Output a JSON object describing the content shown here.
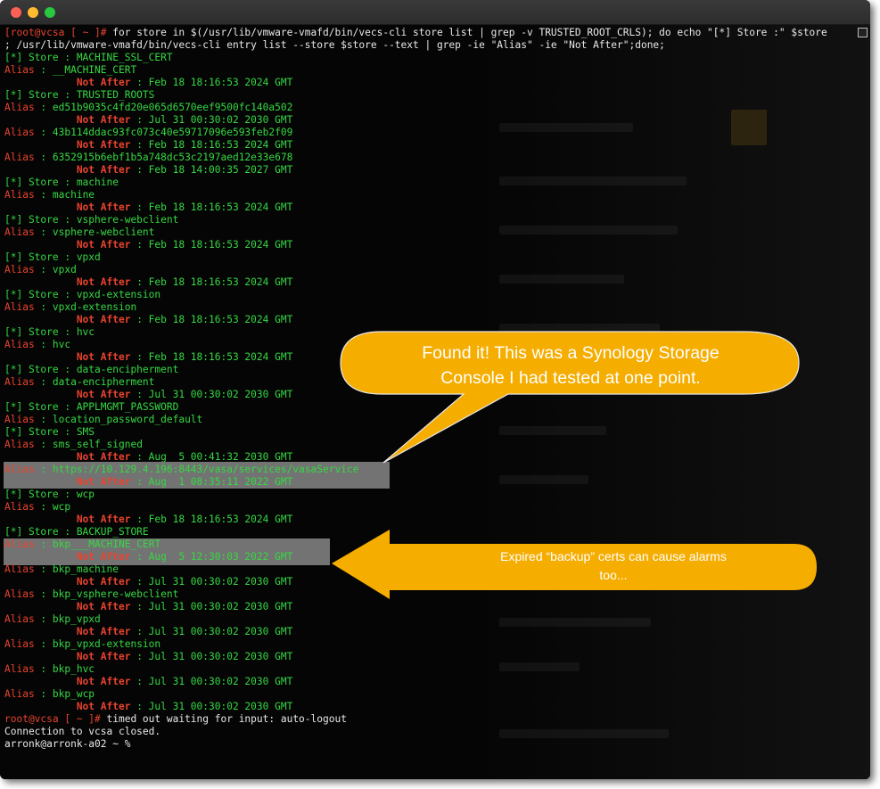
{
  "window": {
    "buttons": [
      "close",
      "minimize",
      "zoom"
    ]
  },
  "terminal": {
    "lines": [
      [
        {
          "t": "[root@vcsa ",
          "c": "red"
        },
        {
          "t": "[ ~ ]# ",
          "c": "red"
        },
        {
          "t": "for store in $(/usr/lib/vmware-vmafd/bin/vecs-cli store list | grep -v TRUSTED_ROOT_CRLS); do echo \"[*] Store :\" $store",
          "c": "white"
        }
      ],
      [
        {
          "t": "; /usr/lib/vmware-vmafd/bin/vecs-cli entry list --store $store --text | grep -ie \"Alias\" -ie \"Not After\";done;",
          "c": "white"
        }
      ],
      [
        {
          "t": "[*] Store : MACHINE_SSL_CERT",
          "c": "green"
        }
      ],
      [
        {
          "t": "Alias",
          "c": "red"
        },
        {
          "t": " : __MACHINE_CERT",
          "c": "green"
        }
      ],
      [
        {
          "t": "            Not After",
          "c": "red-b"
        },
        {
          "t": " : Feb 18 18:16:53 2024 GMT",
          "c": "green"
        }
      ],
      [
        {
          "t": "[*] Store : TRUSTED_ROOTS",
          "c": "green"
        }
      ],
      [
        {
          "t": "Alias",
          "c": "red"
        },
        {
          "t": " : ed51b9035c4fd20e065d6570eef9500fc140a502",
          "c": "green"
        }
      ],
      [
        {
          "t": "            Not After",
          "c": "red-b"
        },
        {
          "t": " : Jul 31 00:30:02 2030 GMT",
          "c": "green"
        }
      ],
      [
        {
          "t": "Alias",
          "c": "red"
        },
        {
          "t": " : 43b114ddac93fc073c40e59717096e593feb2f09",
          "c": "green"
        }
      ],
      [
        {
          "t": "            Not After",
          "c": "red-b"
        },
        {
          "t": " : Feb 18 18:16:53 2024 GMT",
          "c": "green"
        }
      ],
      [
        {
          "t": "Alias",
          "c": "red"
        },
        {
          "t": " : 6352915b6ebf1b5a748dc53c2197aed12e33e678",
          "c": "green"
        }
      ],
      [
        {
          "t": "            Not After",
          "c": "red-b"
        },
        {
          "t": " : Feb 18 14:00:35 2027 GMT",
          "c": "green"
        }
      ],
      [
        {
          "t": "[*] Store : machine",
          "c": "green"
        }
      ],
      [
        {
          "t": "Alias",
          "c": "red"
        },
        {
          "t": " : machine",
          "c": "green"
        }
      ],
      [
        {
          "t": "            Not After",
          "c": "red-b"
        },
        {
          "t": " : Feb 18 18:16:53 2024 GMT",
          "c": "green"
        }
      ],
      [
        {
          "t": "[*] Store : vsphere-webclient",
          "c": "green"
        }
      ],
      [
        {
          "t": "Alias",
          "c": "red"
        },
        {
          "t": " : vsphere-webclient",
          "c": "green"
        }
      ],
      [
        {
          "t": "            Not After",
          "c": "red-b"
        },
        {
          "t": " : Feb 18 18:16:53 2024 GMT",
          "c": "green"
        }
      ],
      [
        {
          "t": "[*] Store : vpxd",
          "c": "green"
        }
      ],
      [
        {
          "t": "Alias",
          "c": "red"
        },
        {
          "t": " : vpxd",
          "c": "green"
        }
      ],
      [
        {
          "t": "            Not After",
          "c": "red-b"
        },
        {
          "t": " : Feb 18 18:16:53 2024 GMT",
          "c": "green"
        }
      ],
      [
        {
          "t": "[*] Store : vpxd-extension",
          "c": "green"
        }
      ],
      [
        {
          "t": "Alias",
          "c": "red"
        },
        {
          "t": " : vpxd-extension",
          "c": "green"
        }
      ],
      [
        {
          "t": "            Not After",
          "c": "red-b"
        },
        {
          "t": " : Feb 18 18:16:53 2024 GMT",
          "c": "green"
        }
      ],
      [
        {
          "t": "[*] Store : hvc",
          "c": "green"
        }
      ],
      [
        {
          "t": "Alias",
          "c": "red"
        },
        {
          "t": " : hvc",
          "c": "green"
        }
      ],
      [
        {
          "t": "            Not After",
          "c": "red-b"
        },
        {
          "t": " : Feb 18 18:16:53 2024 GMT",
          "c": "green"
        }
      ],
      [
        {
          "t": "[*] Store : data-encipherment",
          "c": "green"
        }
      ],
      [
        {
          "t": "Alias",
          "c": "red"
        },
        {
          "t": " : data-encipherment",
          "c": "green"
        }
      ],
      [
        {
          "t": "            Not After",
          "c": "red-b"
        },
        {
          "t": " : Jul 31 00:30:02 2030 GMT",
          "c": "green"
        }
      ],
      [
        {
          "t": "[*] Store : APPLMGMT_PASSWORD",
          "c": "green"
        }
      ],
      [
        {
          "t": "Alias",
          "c": "red"
        },
        {
          "t": " : location_password_default",
          "c": "green"
        }
      ],
      [
        {
          "t": "[*] Store : SMS",
          "c": "green"
        }
      ],
      [
        {
          "t": "Alias",
          "c": "red"
        },
        {
          "t": " : sms_self_signed",
          "c": "green"
        }
      ],
      [
        {
          "t": "            Not After",
          "c": "red-b"
        },
        {
          "t": " : Aug  5 00:41:32 2030 GMT",
          "c": "green"
        }
      ],
      [
        {
          "t": "Alias",
          "c": "red"
        },
        {
          "t": " : https://10.129.4.196:8443/vasa/services/vasaService",
          "c": "green"
        }
      ],
      [
        {
          "t": "            Not After",
          "c": "red-b"
        },
        {
          "t": " : Aug  1 08:35:11 2022 GMT",
          "c": "green"
        }
      ],
      [
        {
          "t": "[*] Store : wcp",
          "c": "green"
        }
      ],
      [
        {
          "t": "Alias",
          "c": "red"
        },
        {
          "t": " : wcp",
          "c": "green"
        }
      ],
      [
        {
          "t": "            Not After",
          "c": "red-b"
        },
        {
          "t": " : Feb 18 18:16:53 2024 GMT",
          "c": "green"
        }
      ],
      [
        {
          "t": "[*] Store : BACKUP_STORE",
          "c": "green"
        }
      ],
      [
        {
          "t": "Alias",
          "c": "red"
        },
        {
          "t": " : bkp___MACHINE_CERT",
          "c": "green"
        }
      ],
      [
        {
          "t": "            Not After",
          "c": "red-b"
        },
        {
          "t": " : Aug  5 12:30:03 2022 GMT",
          "c": "green"
        }
      ],
      [
        {
          "t": "Alias",
          "c": "red"
        },
        {
          "t": " : bkp_machine",
          "c": "green"
        }
      ],
      [
        {
          "t": "            Not After",
          "c": "red-b"
        },
        {
          "t": " : Jul 31 00:30:02 2030 GMT",
          "c": "green"
        }
      ],
      [
        {
          "t": "Alias",
          "c": "red"
        },
        {
          "t": " : bkp_vsphere-webclient",
          "c": "green"
        }
      ],
      [
        {
          "t": "            Not After",
          "c": "red-b"
        },
        {
          "t": " : Jul 31 00:30:02 2030 GMT",
          "c": "green"
        }
      ],
      [
        {
          "t": "Alias",
          "c": "red"
        },
        {
          "t": " : bkp_vpxd",
          "c": "green"
        }
      ],
      [
        {
          "t": "            Not After",
          "c": "red-b"
        },
        {
          "t": " : Jul 31 00:30:02 2030 GMT",
          "c": "green"
        }
      ],
      [
        {
          "t": "Alias",
          "c": "red"
        },
        {
          "t": " : bkp_vpxd-extension",
          "c": "green"
        }
      ],
      [
        {
          "t": "            Not After",
          "c": "red-b"
        },
        {
          "t": " : Jul 31 00:30:02 2030 GMT",
          "c": "green"
        }
      ],
      [
        {
          "t": "Alias",
          "c": "red"
        },
        {
          "t": " : bkp_hvc",
          "c": "green"
        }
      ],
      [
        {
          "t": "            Not After",
          "c": "red-b"
        },
        {
          "t": " : Jul 31 00:30:02 2030 GMT",
          "c": "green"
        }
      ],
      [
        {
          "t": "Alias",
          "c": "red"
        },
        {
          "t": " : bkp_wcp",
          "c": "green"
        }
      ],
      [
        {
          "t": "            Not After",
          "c": "red-b"
        },
        {
          "t": " : Jul 31 00:30:02 2030 GMT",
          "c": "green"
        }
      ],
      [
        {
          "t": "root@vcsa ",
          "c": "red"
        },
        {
          "t": "[ ~ ]# ",
          "c": "red"
        },
        {
          "t": "timed out waiting for input: auto-logout",
          "c": "white"
        }
      ],
      [
        {
          "t": "Connection to vcsa closed.",
          "c": "white"
        }
      ],
      [
        {
          "t": "arronk@arronk-a02 ~ % ",
          "c": "white"
        }
      ]
    ]
  },
  "callouts": {
    "found": {
      "line1": "Found it!  This was a Synology Storage",
      "line2": "Console I had tested at one point."
    },
    "backup": {
      "line1": "Expired “backup” certs can cause alarms",
      "line2": "too..."
    }
  },
  "colors": {
    "prompt_red": "#e8432f",
    "output_green": "#35d842",
    "callout_orange": "#f5ad00",
    "highlight_gray": "#cdcdcd"
  }
}
